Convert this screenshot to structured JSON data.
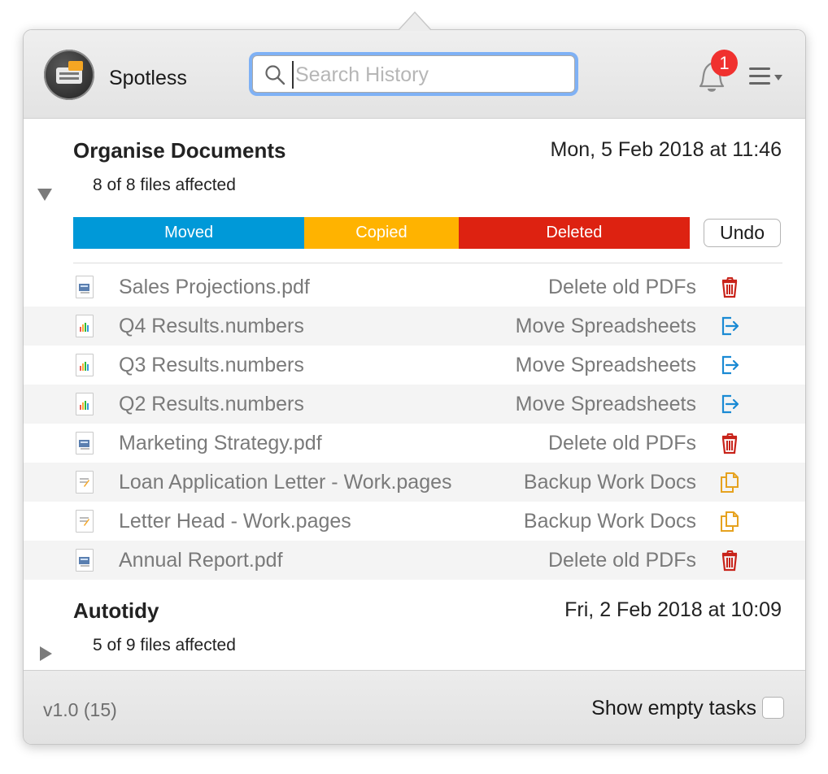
{
  "header": {
    "app_name": "Spotless",
    "search": {
      "placeholder": "Search History",
      "value": ""
    },
    "notification_count": "1"
  },
  "groups": [
    {
      "title": "Organise Documents",
      "date": "Mon, 5 Feb 2018 at 11:46",
      "subtitle": "8 of 8 files affected",
      "expanded": true,
      "breakdown": [
        {
          "label": "Moved",
          "fraction": 0.375,
          "color": "#0099d8"
        },
        {
          "label": "Copied",
          "fraction": 0.25,
          "color": "#ffb300"
        },
        {
          "label": "Deleted",
          "fraction": 0.375,
          "color": "#dd2211"
        }
      ],
      "undo_label": "Undo",
      "files": [
        {
          "name": "Sales Projections.pdf",
          "rule": "Delete old PDFs",
          "action": "delete",
          "file_type": "pdf"
        },
        {
          "name": "Q4 Results.numbers",
          "rule": "Move Spreadsheets",
          "action": "move",
          "file_type": "numbers"
        },
        {
          "name": "Q3 Results.numbers",
          "rule": "Move Spreadsheets",
          "action": "move",
          "file_type": "numbers"
        },
        {
          "name": "Q2 Results.numbers",
          "rule": "Move Spreadsheets",
          "action": "move",
          "file_type": "numbers"
        },
        {
          "name": "Marketing Strategy.pdf",
          "rule": "Delete old PDFs",
          "action": "delete",
          "file_type": "pdf"
        },
        {
          "name": "Loan Application Letter - Work.pages",
          "rule": "Backup Work Docs",
          "action": "copy",
          "file_type": "pages"
        },
        {
          "name": "Letter Head - Work.pages",
          "rule": "Backup Work Docs",
          "action": "copy",
          "file_type": "pages"
        },
        {
          "name": "Annual Report.pdf",
          "rule": "Delete old PDFs",
          "action": "delete",
          "file_type": "pdf"
        }
      ]
    },
    {
      "title": "Autotidy",
      "date": "Fri, 2 Feb 2018 at 10:09",
      "subtitle": "5 of 9 files affected",
      "expanded": false
    }
  ],
  "action_colors": {
    "delete": "#c8231a",
    "move": "#1a8ad4",
    "copy": "#e6a21f"
  },
  "footer": {
    "version": "v1.0 (15)",
    "show_empty_label": "Show empty tasks",
    "show_empty_checked": false
  }
}
